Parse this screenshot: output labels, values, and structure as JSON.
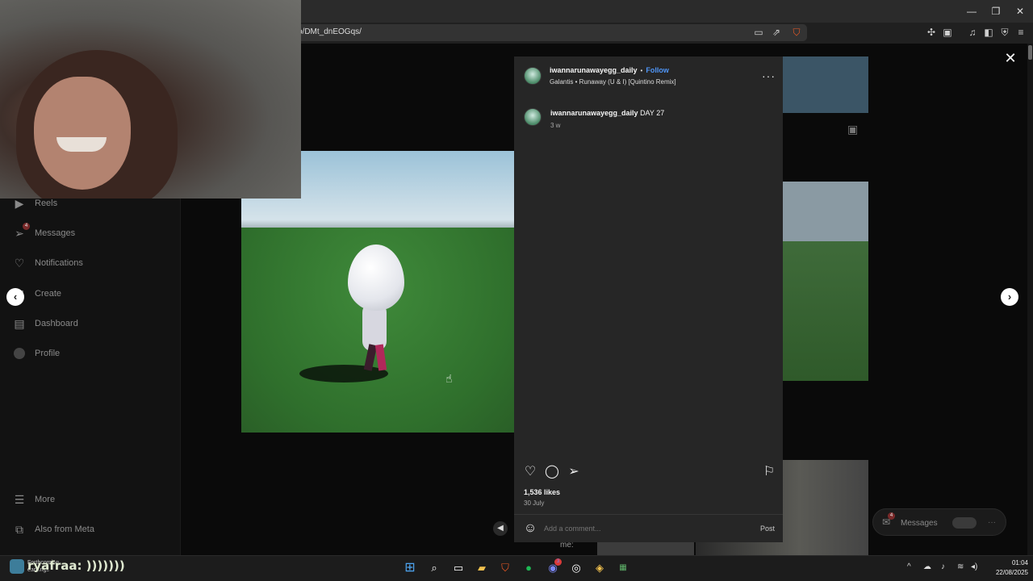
{
  "browser": {
    "url": "o/DMt_dnEOGqs/"
  },
  "sidebar": {
    "items": [
      {
        "label": "Reels",
        "icon": "reels-icon"
      },
      {
        "label": "Messages",
        "icon": "messages-icon",
        "badge": "4"
      },
      {
        "label": "Notifications",
        "icon": "heart-icon"
      },
      {
        "label": "Create",
        "icon": "plus-icon"
      },
      {
        "label": "Dashboard",
        "icon": "dashboard-icon"
      },
      {
        "label": "Profile",
        "icon": "avatar-icon"
      }
    ],
    "bottom": [
      {
        "label": "More",
        "icon": "menu-icon"
      },
      {
        "label": "Also from Meta",
        "icon": "meta-icon"
      }
    ]
  },
  "post": {
    "username": "iwannarunawayegg_daily",
    "follow": "Follow",
    "separator": "•",
    "audio": "Galantis • Runaway (U & I) [Quintino Remix]",
    "caption_user": "iwannarunawayegg_daily",
    "caption_text": "DAY 27",
    "caption_time": "3 w",
    "likes": "1,536 likes",
    "date": "30 July",
    "comment_placeholder": "Add a comment...",
    "post_button": "Post"
  },
  "feed": {
    "caption_fragment": "me:"
  },
  "messages_pill": {
    "label": "Messages",
    "badge": "4"
  },
  "taskbar": {
    "overlay_text": "ryafraa: )))))))",
    "weather_line1": "Forthcoming",
    "weather_line2": "earnings",
    "spotify_badge": "",
    "discord_badge": "3",
    "time": "01:04",
    "date": "22/08/2025"
  },
  "colors": {
    "accent": "#4f95f7",
    "panel": "#262626",
    "page": "#0a0a0a"
  }
}
